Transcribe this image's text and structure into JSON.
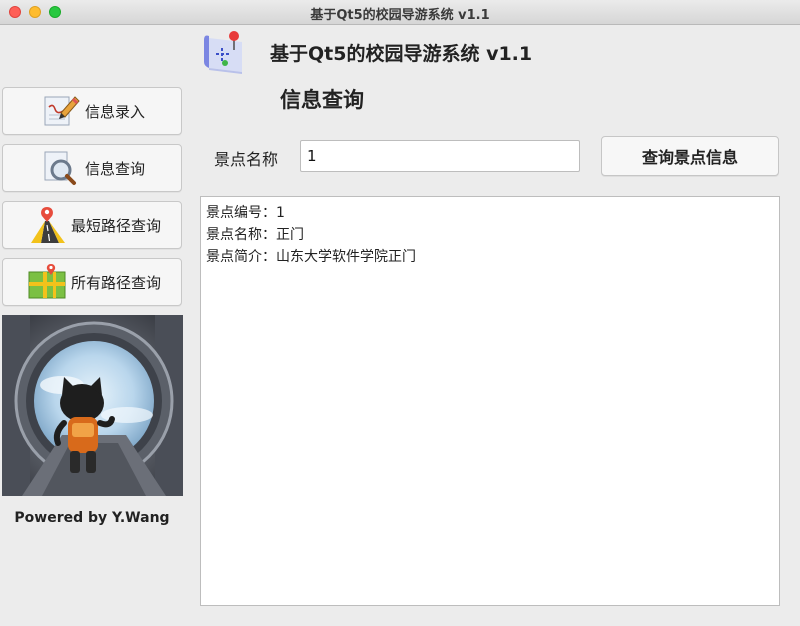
{
  "window": {
    "title": "基于Qt5的校园导游系统 v1.1"
  },
  "header": {
    "app_title": "基于Qt5的校园导游系统 v1.1",
    "section_title": "信息查询",
    "logo_icon": "map-pin-icon"
  },
  "sidebar": {
    "items": [
      {
        "label": "信息录入",
        "icon": "pencil-edit-icon"
      },
      {
        "label": "信息查询",
        "icon": "magnifier-icon"
      },
      {
        "label": "最短路径查询",
        "icon": "road-pin-icon"
      },
      {
        "label": "所有路径查询",
        "icon": "map-icon"
      }
    ],
    "powered_by": "Powered by Y.Wang"
  },
  "search": {
    "label": "景点名称",
    "value": "1",
    "button_label": "查询景点信息"
  },
  "result": {
    "lines": [
      "景点编号：1",
      "景点名称：正门",
      "景点简介：山东大学软件学院正门"
    ]
  },
  "colors": {
    "window_bg": "#ececec",
    "close": "#fe5f57",
    "minimize": "#febc2e",
    "maximize": "#28c840"
  }
}
